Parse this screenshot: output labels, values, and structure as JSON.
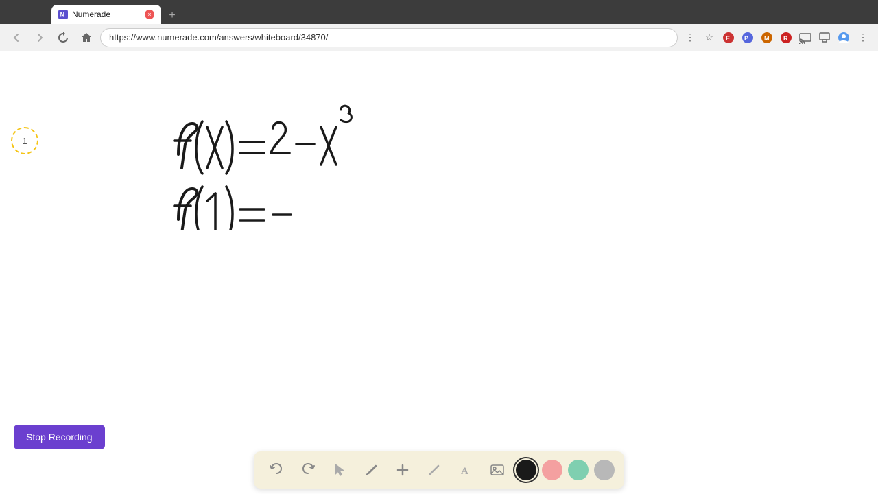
{
  "browser": {
    "tab": {
      "title": "Numerade",
      "favicon_label": "numerade-logo",
      "close_label": "×"
    },
    "new_tab_label": "+",
    "address": "https://www.numerade.com/answers/whiteboard/34870/",
    "nav": {
      "back": "←",
      "forward": "→",
      "reload": "↻",
      "home": "⌂"
    }
  },
  "whiteboard": {
    "circle_number": "1",
    "math_lines": [
      "f(x) = 2 - x³",
      "f(1) ="
    ]
  },
  "stop_recording_btn": "Stop Recording",
  "toolbar": {
    "undo_label": "↺",
    "redo_label": "↻",
    "select_label": "▶",
    "pen_label": "✏",
    "plus_label": "+",
    "slash_label": "/",
    "text_label": "A",
    "image_label": "🖼",
    "colors": [
      {
        "name": "black",
        "value": "#1a1a1a"
      },
      {
        "name": "pink",
        "value": "#f4a0a0"
      },
      {
        "name": "green",
        "value": "#7fcfb0"
      },
      {
        "name": "gray",
        "value": "#b0b0b0"
      }
    ],
    "active_color": "black"
  }
}
